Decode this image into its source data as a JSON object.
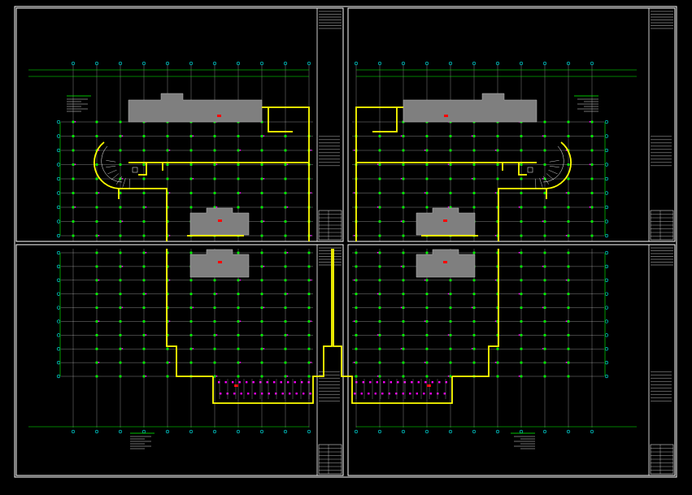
{
  "viewer": {
    "background": "#000000",
    "frame_color": "#ffffff",
    "grid_line_color": "#ffffff",
    "dimension_color": "#00ff00",
    "axis_bubble_color": "#00ffff",
    "wall_color": "#ffff00",
    "column_color": "#00ff00",
    "hatch_color": "#7f7f7f",
    "accent_red": "#ff0000",
    "accent_magenta": "#ff00ff",
    "sheet_count": 4
  },
  "sheets": [
    {
      "quadrant": "top-left",
      "mirrored": false,
      "variant": "upper"
    },
    {
      "quadrant": "top-right",
      "mirrored": true,
      "variant": "upper"
    },
    {
      "quadrant": "bottom-left",
      "mirrored": false,
      "variant": "lower"
    },
    {
      "quadrant": "bottom-right",
      "mirrored": true,
      "variant": "lower"
    }
  ]
}
